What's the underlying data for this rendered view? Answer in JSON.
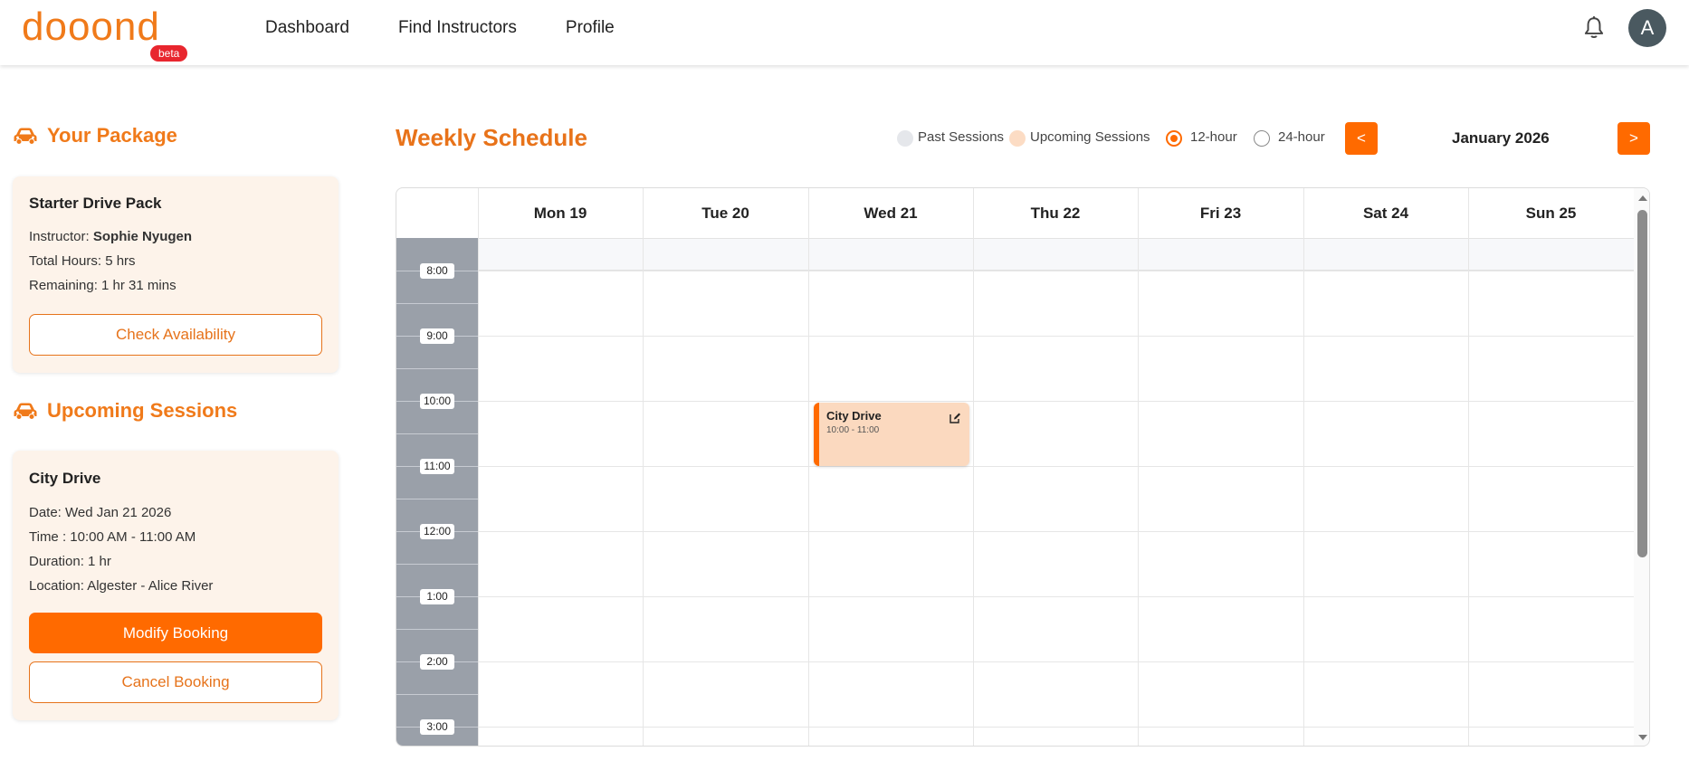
{
  "header": {
    "logo_text": "dooond",
    "beta_label": "beta",
    "nav": [
      {
        "label": "Dashboard"
      },
      {
        "label": "Find Instructors"
      },
      {
        "label": "Profile"
      }
    ],
    "avatar_initial": "A",
    "icons": {
      "bell": "bell-icon"
    }
  },
  "package": {
    "section_title": "Your Package",
    "name": "Starter Drive Pack",
    "instructor_label": "Instructor:",
    "instructor_name": "Sophie Nyugen",
    "total_hours": "Total Hours: 5 hrs",
    "remaining": "Remaining: 1 hr 31 mins",
    "check_button": "Check Availability"
  },
  "upcoming": {
    "section_title": "Upcoming Sessions",
    "session": {
      "title": "City Drive",
      "date": "Date: Wed Jan 21 2026",
      "time": "Time : 10:00 AM - 11:00 AM",
      "duration": "Duration: 1 hr",
      "location": "Location: Algester - Alice River"
    },
    "modify_button": "Modify Booking",
    "cancel_button": "Cancel Booking"
  },
  "schedule": {
    "title": "Weekly Schedule",
    "legend": {
      "past": "Past Sessions",
      "upcoming": "Upcoming Sessions"
    },
    "format_options": {
      "h12": "12-hour",
      "h24": "24-hour",
      "selected": "12-hour"
    },
    "prev_label": "<",
    "next_label": ">",
    "month_label": "January 2026",
    "days": [
      "Mon 19",
      "Tue 20",
      "Wed 21",
      "Thu 22",
      "Fri 23",
      "Sat 24",
      "Sun 25"
    ],
    "times": [
      "8:00",
      "9:00",
      "10:00",
      "11:00",
      "12:00",
      "1:00",
      "2:00",
      "3:00"
    ],
    "event": {
      "title": "City Drive",
      "time": "10:00 - 11:00"
    }
  },
  "colors": {
    "accent": "#ff6a00",
    "title_orange": "#e8731a",
    "card_bg": "#fdf3ea",
    "event_bg": "#fbd9bf",
    "past_legend": "#e5e7eb",
    "upcoming_legend": "#fcdcc4",
    "time_column": "#9aa0a9"
  }
}
